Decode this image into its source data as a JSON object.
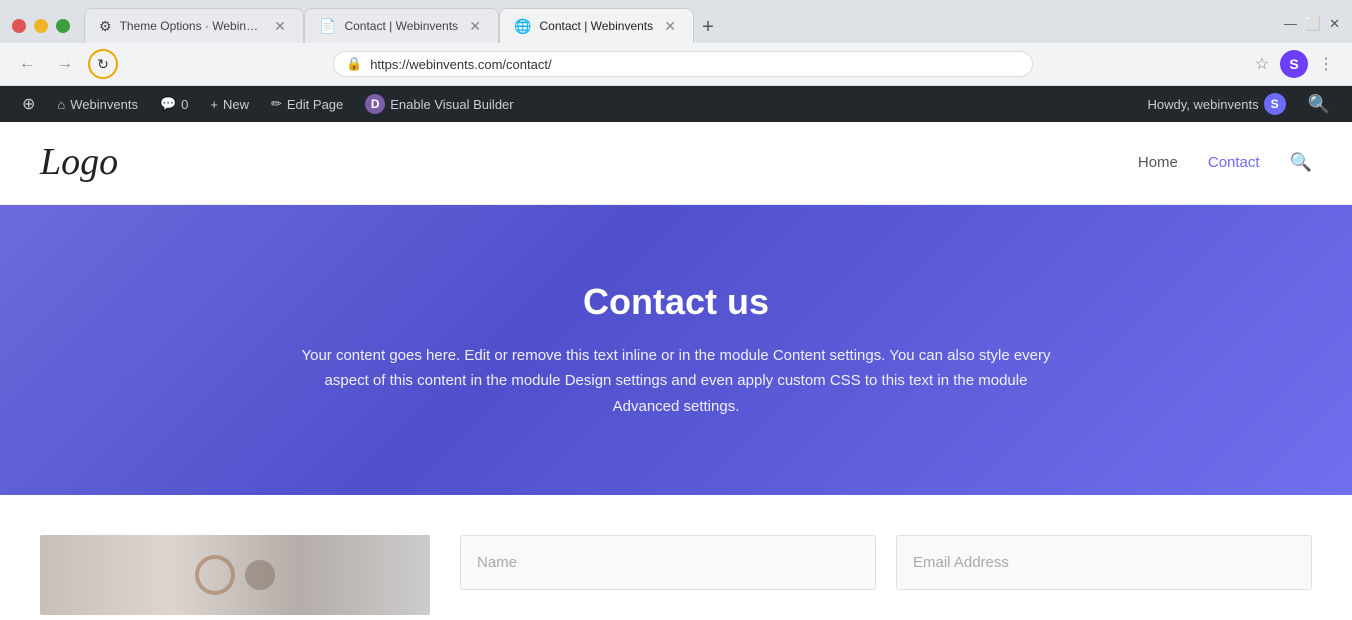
{
  "browser": {
    "tabs": [
      {
        "id": "tab-1",
        "title": "Theme Options · Webinvents —",
        "favicon": "⚙",
        "active": false
      },
      {
        "id": "tab-2",
        "title": "Contact | Webinvents",
        "favicon": "📄",
        "active": false
      },
      {
        "id": "tab-3",
        "title": "Contact | Webinvents",
        "favicon": "🌐",
        "active": true
      }
    ],
    "url": "https://webinvents.com/contact/",
    "reload_title": "Reload page"
  },
  "wp_admin_bar": {
    "items": [
      {
        "id": "wp-logo",
        "label": "WordPress",
        "icon": "W"
      },
      {
        "id": "webinvents",
        "label": "Webinvents",
        "icon": "⌂"
      },
      {
        "id": "comments",
        "label": "0",
        "icon": "💬"
      },
      {
        "id": "new",
        "label": "New",
        "icon": "+"
      },
      {
        "id": "edit-page",
        "label": "Edit Page",
        "icon": "✏"
      },
      {
        "id": "enable-vb",
        "label": "Enable Visual Builder",
        "icon": "D"
      }
    ],
    "howdy_text": "Howdy, webinvents",
    "avatar_initial": "S",
    "search_icon": "🔍"
  },
  "site_header": {
    "logo_text": "Logo",
    "nav_links": [
      {
        "id": "home",
        "label": "Home",
        "active": false
      },
      {
        "id": "contact",
        "label": "Contact",
        "active": true
      }
    ]
  },
  "hero": {
    "title": "Contact us",
    "description": "Your content goes here. Edit or remove this text inline or in the module Content settings. You can also style every aspect of this content in the module Design settings and even apply custom CSS to this text in the module Advanced settings."
  },
  "contact_form": {
    "name_placeholder": "Name",
    "email_placeholder": "Email Address"
  }
}
